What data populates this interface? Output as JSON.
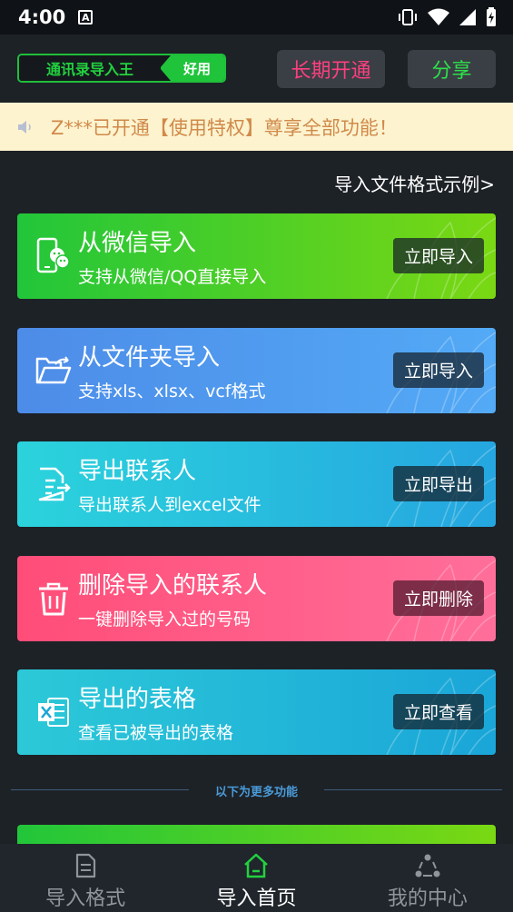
{
  "status_bar": {
    "time": "4:00",
    "a_icon_letter": "A"
  },
  "header": {
    "brand_name": "通讯录导入王",
    "brand_tag": "好用",
    "vip_button": "长期开通",
    "share_button": "分享"
  },
  "notice": {
    "text": "Z***已开通【使用特权】尊享全部功能！"
  },
  "format_link": "导入文件格式示例>",
  "cards": [
    {
      "title": "从微信导入",
      "subtitle": "支持从微信/QQ直接导入",
      "action": "立即导入",
      "icon": "wechat-phone-icon",
      "color": "#22c63a"
    },
    {
      "title": "从文件夹导入",
      "subtitle": "支持xls、xlsx、vcf格式",
      "action": "立即导入",
      "icon": "folder-open-icon",
      "color": "#4d8ce8"
    },
    {
      "title": "导出联系人",
      "subtitle": "导出联系人到excel文件",
      "action": "立即导出",
      "icon": "file-export-icon",
      "color": "#2bd3dc"
    },
    {
      "title": "删除导入的联系人",
      "subtitle": "一键删除导入过的号码",
      "action": "立即删除",
      "icon": "trash-icon",
      "color": "#ff4d78"
    },
    {
      "title": "导出的表格",
      "subtitle": "查看已被导出的表格",
      "action": "立即查看",
      "icon": "excel-icon",
      "color": "#2cc9d8"
    }
  ],
  "more_divider": "以下为更多功能",
  "bottom_nav": [
    {
      "label": "导入格式",
      "icon": "document-icon",
      "active": false
    },
    {
      "label": "导入首页",
      "icon": "home-icon",
      "active": true
    },
    {
      "label": "我的中心",
      "icon": "share-nodes-icon",
      "active": false
    }
  ],
  "colors": {
    "accent_green": "#22d13f",
    "vip_pink": "#ff3f7f",
    "notice_bg": "#fdf3cf",
    "notice_text": "#d08a4a",
    "background": "#1d2227"
  }
}
